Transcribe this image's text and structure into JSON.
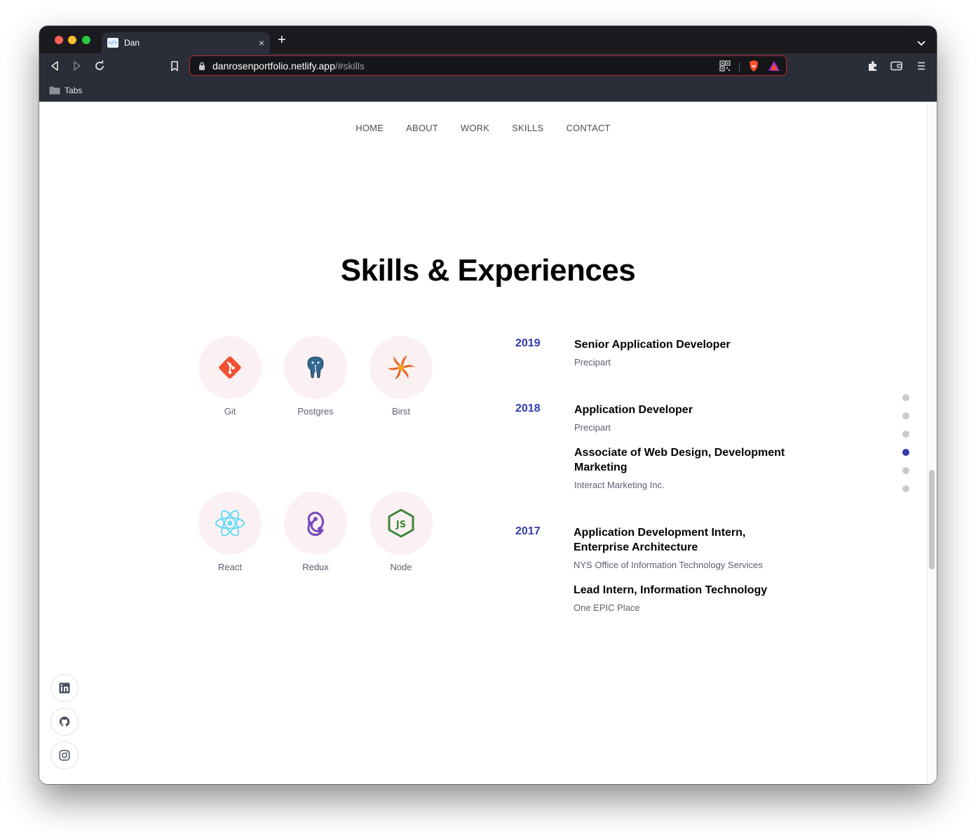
{
  "browser": {
    "tab_title": "Dan",
    "tab_close": "×",
    "new_tab": "+",
    "url_host": "danrosenportfolio.netlify.app",
    "url_path": "/#skills",
    "bookmark_label": "Tabs",
    "icons": [
      "back-icon",
      "forward-icon",
      "reload-icon",
      "bookmark-icon",
      "lock-icon",
      "qr-code-icon",
      "brave-shield-icon",
      "brave-rewards-icon",
      "extensions-icon",
      "wallet-icon",
      "menu-icon",
      "folder-icon"
    ]
  },
  "nav": {
    "items": [
      "HOME",
      "ABOUT",
      "WORK",
      "SKILLS",
      "CONTACT"
    ]
  },
  "section": {
    "title": "Skills & Experiences"
  },
  "skills": [
    {
      "name": "Git",
      "icon": "git-icon",
      "color": "#f05033"
    },
    {
      "name": "Postgres",
      "icon": "postgres-icon",
      "color": "#336791"
    },
    {
      "name": "Birst",
      "icon": "birst-icon",
      "color": "#e8661c"
    },
    {
      "name": "React",
      "icon": "react-icon",
      "color": "#61dafb"
    },
    {
      "name": "Redux",
      "icon": "redux-icon",
      "color": "#764abc"
    },
    {
      "name": "Node",
      "icon": "node-icon",
      "color": "#3c873a"
    }
  ],
  "experiences": [
    {
      "year": "2019",
      "works": [
        {
          "title": "Senior Application Developer",
          "company": "Precipart"
        }
      ]
    },
    {
      "year": "2018",
      "works": [
        {
          "title": "Application Developer",
          "company": "Precipart"
        },
        {
          "title": "Associate of Web Design, Development Marketing",
          "company": "Interact Marketing Inc."
        }
      ]
    },
    {
      "year": "2017",
      "works": [
        {
          "title": "Application Development Intern, Enterprise Architecture",
          "company": "NYS Office of Information Technology Services"
        },
        {
          "title": "Lead Intern, Information Technology",
          "company": "One EPIC Place"
        }
      ]
    }
  ],
  "page_dots": {
    "count": 6,
    "active_index": 3
  },
  "socials": [
    "linkedin-icon",
    "github-icon",
    "instagram-icon"
  ],
  "colors": {
    "accent": "#313bac",
    "skill_bg": "#fcf1f2",
    "text_gray": "#5b6070"
  }
}
